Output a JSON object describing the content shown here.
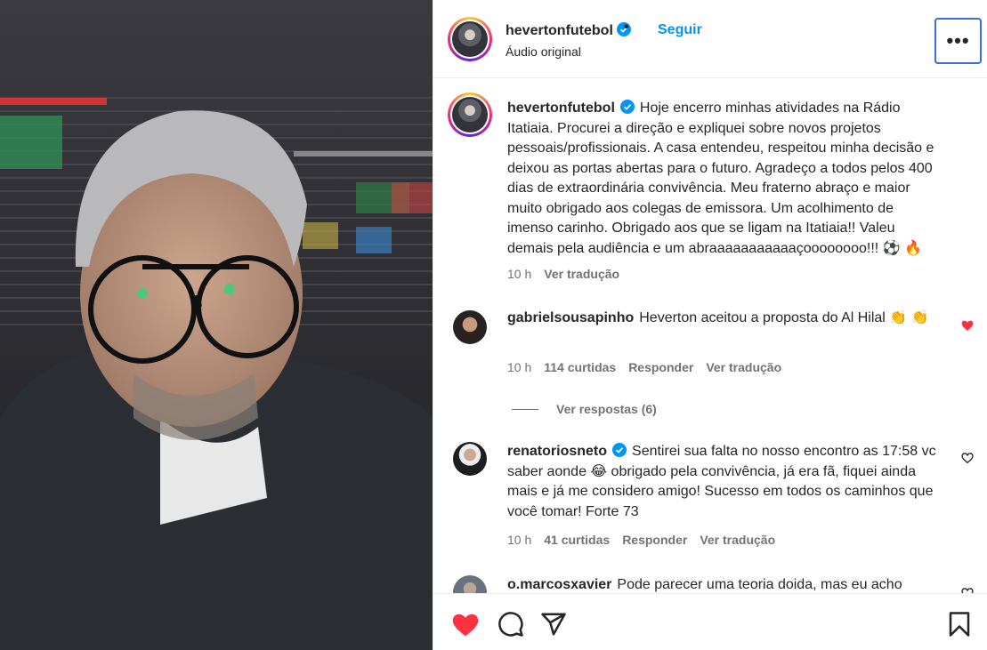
{
  "header": {
    "username": "hevertonfutebol",
    "dot": "•",
    "follow_label": "Seguir",
    "audio_label": "Áudio original",
    "more_label": "•••"
  },
  "caption": {
    "username": "hevertonfutebol",
    "text": "Hoje encerro minhas atividades na Rádio Itatiaia. Procurei a direção e expliquei sobre novos projetos pessoais/profissionais. A casa entendeu, respeitou minha decisão e deixou as portas abertas para o futuro. Agradeço a todos pelos 400 dias de extraordinária convivência. Meu fraterno abraço e maior muito obrigado aos colegas de emissora. Um acolhimento de imenso carinho. Obrigado aos que se ligam na Itatiaia!! Valeu demais pela audiência e um abraaaaaaaaaaaçoooooooo!!! ⚽ 🔥",
    "time": "10 h",
    "translate": "Ver tradução"
  },
  "comments": [
    {
      "username": "gabrielsousapinho",
      "text": "Heverton aceitou a proposta do Al Hilal 👏 👏",
      "time": "10 h",
      "likes": "114 curtidas",
      "reply": "Responder",
      "translate": "Ver tradução",
      "liked": true
    },
    {
      "username": "renatoriosneto",
      "text": "Sentirei sua falta no nosso encontro as 17:58 vc saber aonde 😂 obrigado pela convivência, já era fã, fiquei ainda mais e já me considero amigo! Sucesso em todos os caminhos que você tomar! Forte 73",
      "time": "10 h",
      "likes": "41 curtidas",
      "reply": "Responder",
      "translate": "Ver tradução",
      "liked": false
    },
    {
      "username": "o.marcosxavier",
      "text": "Pode parecer uma teoria doida, mas eu acho",
      "liked": false
    }
  ],
  "replies_label": "Ver respostas (6)",
  "colors": {
    "accent": "#0095f6",
    "like": "#ff3040",
    "muted": "#737373",
    "focus": "#3a6ed8"
  },
  "icons": {
    "like": "heart-filled-icon",
    "comment": "comment-icon",
    "share": "share-icon",
    "save": "bookmark-icon"
  }
}
